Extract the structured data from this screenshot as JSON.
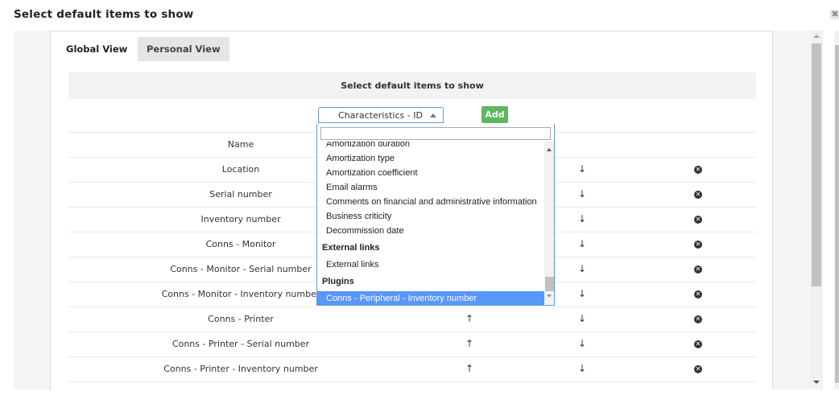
{
  "dialog": {
    "title": "Select default items to show",
    "close_glyph": "✖"
  },
  "tabs": [
    {
      "label": "Global View",
      "active": true
    },
    {
      "label": "Personal View",
      "active": false
    }
  ],
  "section_header": "Select default items to show",
  "selector": {
    "value": "Characteristics - ID",
    "add_label": "Add"
  },
  "dropdown": {
    "search_value": "",
    "items": [
      {
        "kind": "option",
        "label": "Amortization duration"
      },
      {
        "kind": "option",
        "label": "Amortization type"
      },
      {
        "kind": "option",
        "label": "Amortization coefficient"
      },
      {
        "kind": "option",
        "label": "Email alarms"
      },
      {
        "kind": "option",
        "label": "Comments on financial and administrative information"
      },
      {
        "kind": "option",
        "label": "Business criticity"
      },
      {
        "kind": "option",
        "label": "Decommission date"
      },
      {
        "kind": "group",
        "label": "External links"
      },
      {
        "kind": "option",
        "label": "External links"
      },
      {
        "kind": "group",
        "label": "Plugins"
      },
      {
        "kind": "option",
        "label": "Conns - Peripheral - Inventory number",
        "selected": true
      }
    ]
  },
  "rows": [
    {
      "name": "Name",
      "up": false,
      "down": false,
      "del": false
    },
    {
      "name": "Location",
      "up": true,
      "down": true,
      "del": true
    },
    {
      "name": "Serial number",
      "up": true,
      "down": true,
      "del": true
    },
    {
      "name": "Inventory number",
      "up": true,
      "down": true,
      "del": true
    },
    {
      "name": "Conns - Monitor",
      "up": true,
      "down": true,
      "del": true
    },
    {
      "name": "Conns - Monitor - Serial number",
      "up": true,
      "down": true,
      "del": true
    },
    {
      "name": "Conns - Monitor - Inventory number",
      "up": true,
      "down": true,
      "del": true
    },
    {
      "name": "Conns - Printer",
      "up": true,
      "down": true,
      "del": true
    },
    {
      "name": "Conns - Printer - Serial number",
      "up": true,
      "down": true,
      "del": true
    },
    {
      "name": "Conns - Printer - Inventory number",
      "up": true,
      "down": true,
      "del": true
    }
  ],
  "icons": {
    "up": "↑",
    "down": "↓",
    "delete": "✕"
  }
}
